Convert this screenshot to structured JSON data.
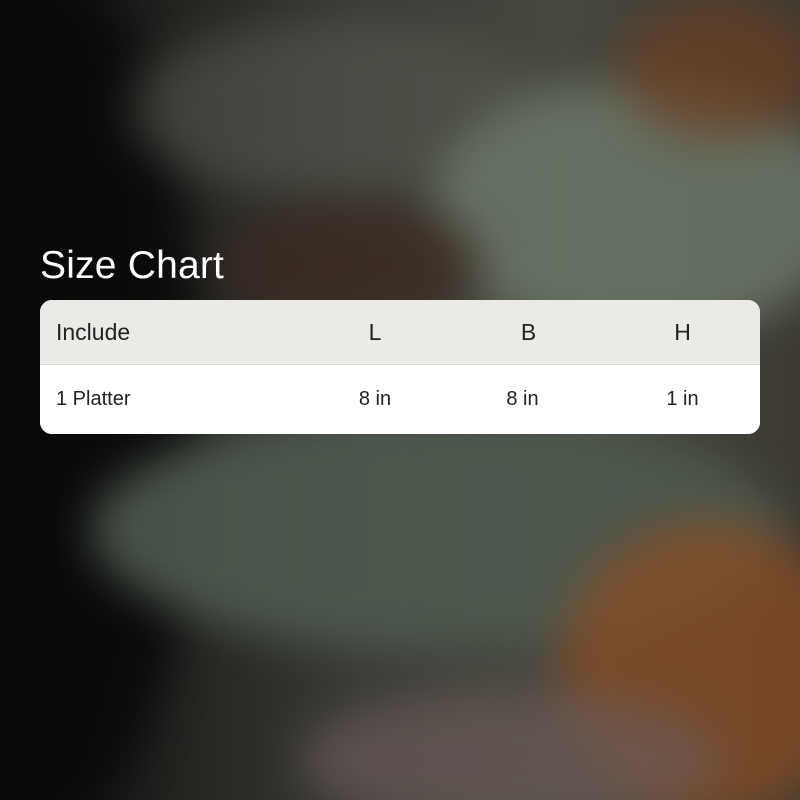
{
  "title": "Size Chart",
  "table": {
    "headers": [
      "Include",
      "L",
      "B",
      "H"
    ],
    "rows": [
      [
        "1 Platter",
        "8 in",
        "8 in",
        "1 in"
      ]
    ]
  },
  "colors": {
    "header_bg": "#ebeae6",
    "row_bg": "#ffffff",
    "title_text": "#ffffff",
    "body_text": "#222222"
  }
}
